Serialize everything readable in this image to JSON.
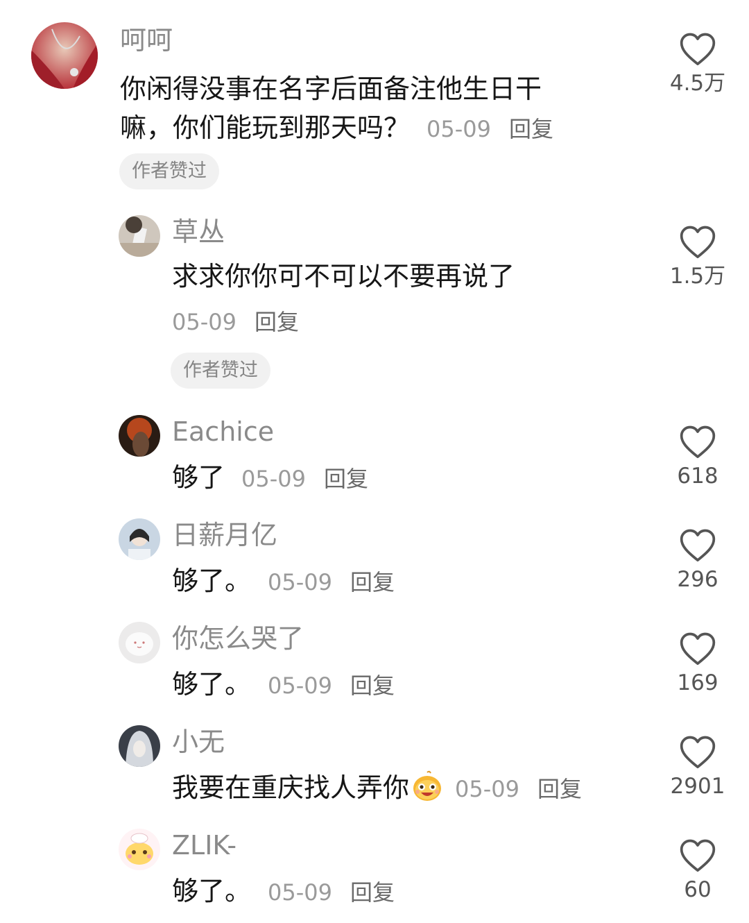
{
  "comments": [
    {
      "username": "呵呵",
      "text_line1": "你闲得没事在名字后面备注他生日干",
      "text_line2": "嘛，你们能玩到那天吗？",
      "date": "05-09",
      "reply": "回复",
      "badge": "作者赞过",
      "likes": "4.5万"
    },
    {
      "username": "草丛",
      "text": "求求你你可不可以不要再说了",
      "date": "05-09",
      "reply": "回复",
      "badge": "作者赞过",
      "likes": "1.5万"
    },
    {
      "username": "Eachice",
      "text": "够了",
      "date": "05-09",
      "reply": "回复",
      "likes": "618"
    },
    {
      "username": "日薪月亿",
      "text": "够了。",
      "date": "05-09",
      "reply": "回复",
      "likes": "296"
    },
    {
      "username": "你怎么哭了",
      "text": "够了。",
      "date": "05-09",
      "reply": "回复",
      "likes": "169"
    },
    {
      "username": "小无",
      "text": "我要在重庆找人弄你",
      "emoji": "grinning-bean-emoji",
      "date": "05-09",
      "reply": "回复",
      "likes": "2901"
    },
    {
      "username": "ZLIK-",
      "text": "够了。",
      "date": "05-09",
      "reply": "回复",
      "likes": "60"
    }
  ],
  "icons": {
    "like": "heart-outline-icon"
  },
  "colors": {
    "username": "#8a8a8a",
    "text": "#161616",
    "meta": "#9a9a9a",
    "badge_bg": "#f1f1f1"
  }
}
